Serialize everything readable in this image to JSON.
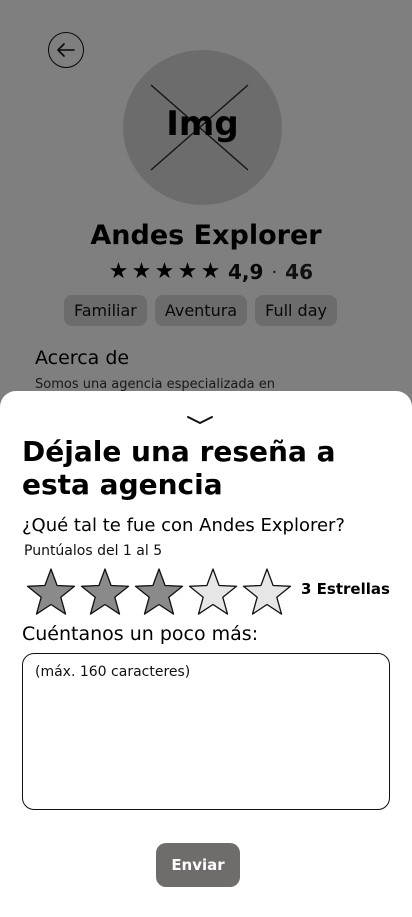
{
  "profile": {
    "avatar_label": "Img",
    "name": "Andes Explorer",
    "rating": "4,9",
    "separator": "·",
    "review_count": "46",
    "rating_stars": 5,
    "tags": [
      "Familiar",
      "Aventura",
      "Full day"
    ],
    "about_title": "Acerca de",
    "about_text": "Somos una agencia especializada en"
  },
  "review_sheet": {
    "title": "Déjale una reseña a esta agencia",
    "question": "¿Qué tal te fue con Andes Explorer?",
    "hint": "Puntúalos del 1 al 5",
    "selected_stars": 3,
    "max_stars": 5,
    "stars_label": "3 Estrellas",
    "comment_label": "Cuéntanos un poco más:",
    "comment_placeholder": "(máx. 160 caracteres)",
    "comment_value": "",
    "submit_label": "Enviar"
  },
  "colors": {
    "overlay": "#000000",
    "star_filled": "#8a8a8a",
    "star_empty": "#e6e6e6",
    "submit_bg": "#6f6c6c"
  }
}
